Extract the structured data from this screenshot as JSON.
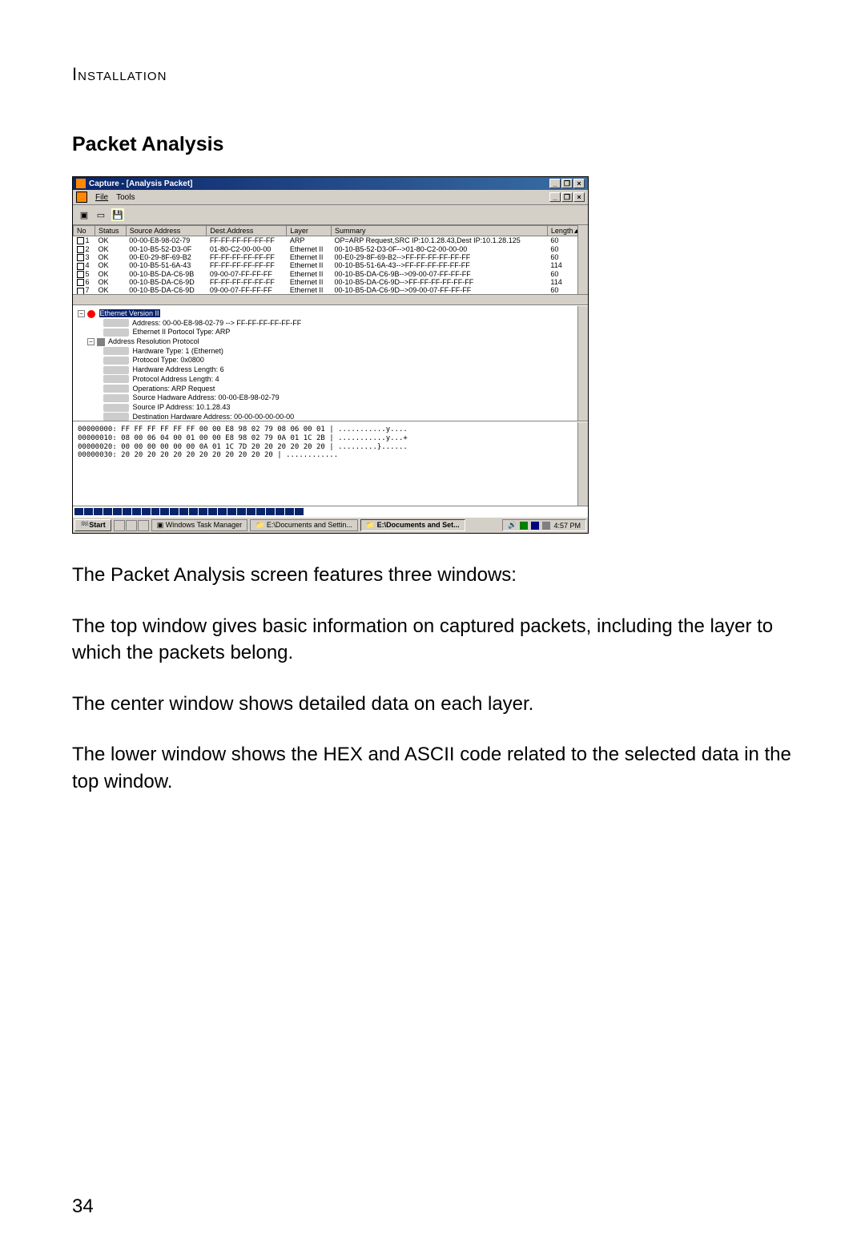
{
  "page": {
    "header": "Installation",
    "section_title": "Packet Analysis",
    "number": "34"
  },
  "screenshot": {
    "titlebar": {
      "title": "Capture - [Analysis Packet]"
    },
    "menubar": {
      "file": "File",
      "tools": "Tools"
    },
    "table": {
      "headers": {
        "no": "No",
        "status": "Status",
        "src": "Source Address",
        "dest": "Dest.Address",
        "layer": "Layer",
        "summary": "Summary",
        "length": "Length"
      },
      "rows": [
        {
          "no": "1",
          "status": "OK",
          "src": "00-00-E8-98-02-79",
          "dest": "FF-FF-FF-FF-FF-FF",
          "layer": "ARP",
          "summary": "OP=ARP Request,SRC IP:10.1.28.43,Dest IP:10.1.28.125",
          "length": "60"
        },
        {
          "no": "2",
          "status": "OK",
          "src": "00-10-B5-52-D3-0F",
          "dest": "01-80-C2-00-00-00",
          "layer": "Ethernet II",
          "summary": "00-10-B5-52-D3-0F-->01-80-C2-00-00-00",
          "length": "60"
        },
        {
          "no": "3",
          "status": "OK",
          "src": "00-E0-29-8F-69-B2",
          "dest": "FF-FF-FF-FF-FF-FF",
          "layer": "Ethernet II",
          "summary": "00-E0-29-8F-69-B2-->FF-FF-FF-FF-FF-FF",
          "length": "60"
        },
        {
          "no": "4",
          "status": "OK",
          "src": "00-10-B5-51-6A-43",
          "dest": "FF-FF-FF-FF-FF-FF",
          "layer": "Ethernet II",
          "summary": "00-10-B5-51-6A-43-->FF-FF-FF-FF-FF-FF",
          "length": "114"
        },
        {
          "no": "5",
          "status": "OK",
          "src": "00-10-B5-DA-C6-9B",
          "dest": "09-00-07-FF-FF-FF",
          "layer": "Ethernet II",
          "summary": "00-10-B5-DA-C6-9B-->09-00-07-FF-FF-FF",
          "length": "60"
        },
        {
          "no": "6",
          "status": "OK",
          "src": "00-10-B5-DA-C6-9D",
          "dest": "FF-FF-FF-FF-FF-FF",
          "layer": "Ethernet II",
          "summary": "00-10-B5-DA-C6-9D-->FF-FF-FF-FF-FF-FF",
          "length": "114"
        },
        {
          "no": "7",
          "status": "OK",
          "src": "00-10-B5-DA-C6-9D",
          "dest": "09-00-07-FF-FF-FF",
          "layer": "Ethernet II",
          "summary": "00-10-B5-DA-C6-9D-->09-00-07-FF-FF-FF",
          "length": "60"
        }
      ]
    },
    "tree": {
      "root": "Ethernet Version II",
      "root_children": [
        "Address: 00-00-E8-98-02-79 --> FF-FF-FF-FF-FF-FF",
        "Ethernet II Portocol Type: ARP"
      ],
      "arp_root": "Address Resolution Protocol",
      "arp_children": [
        "Hardware Type: 1 (Ethernet)",
        "Protocol Type: 0x0800",
        "Hardware Address Length: 6",
        "Protocol Address Length: 4",
        "Operations: ARP Request",
        "Source Hadware Address: 00-00-E8-98-02-79",
        "Source IP Address: 10.1.28.43",
        "Destination Hardware Address: 00-00-00-00-00-00"
      ]
    },
    "hex": {
      "lines": [
        "00000000:  FF FF FF FF FF FF 00 00 E8 98 02 79 08 06 00 01  | ...........y....",
        "00000010:  08 00 06 04 00 01 00 00 E8 98 02 79 0A 01 1C 2B  | ...........y...+",
        "00000020:  00 00 00 00 00 00 0A 01 1C 7D 20 20 20 20 20 20  | .........}......",
        "00000030:  20 20 20 20 20 20 20 20 20 20 20 20  | ............"
      ]
    },
    "taskbar": {
      "start": "Start",
      "task1": "Windows Task Manager",
      "task2": "E:\\Documents and Settin...",
      "task3": "E:\\Documents and Set...",
      "clock": "4:57 PM"
    }
  },
  "body": {
    "p1": "The Packet Analysis screen features three windows:",
    "p2": "The top window gives basic information on captured packets, including the layer to which the packets belong.",
    "p3": "The center window shows detailed data on each layer.",
    "p4": "The lower window shows the HEX and ASCII code related to the selected data in the top window."
  }
}
